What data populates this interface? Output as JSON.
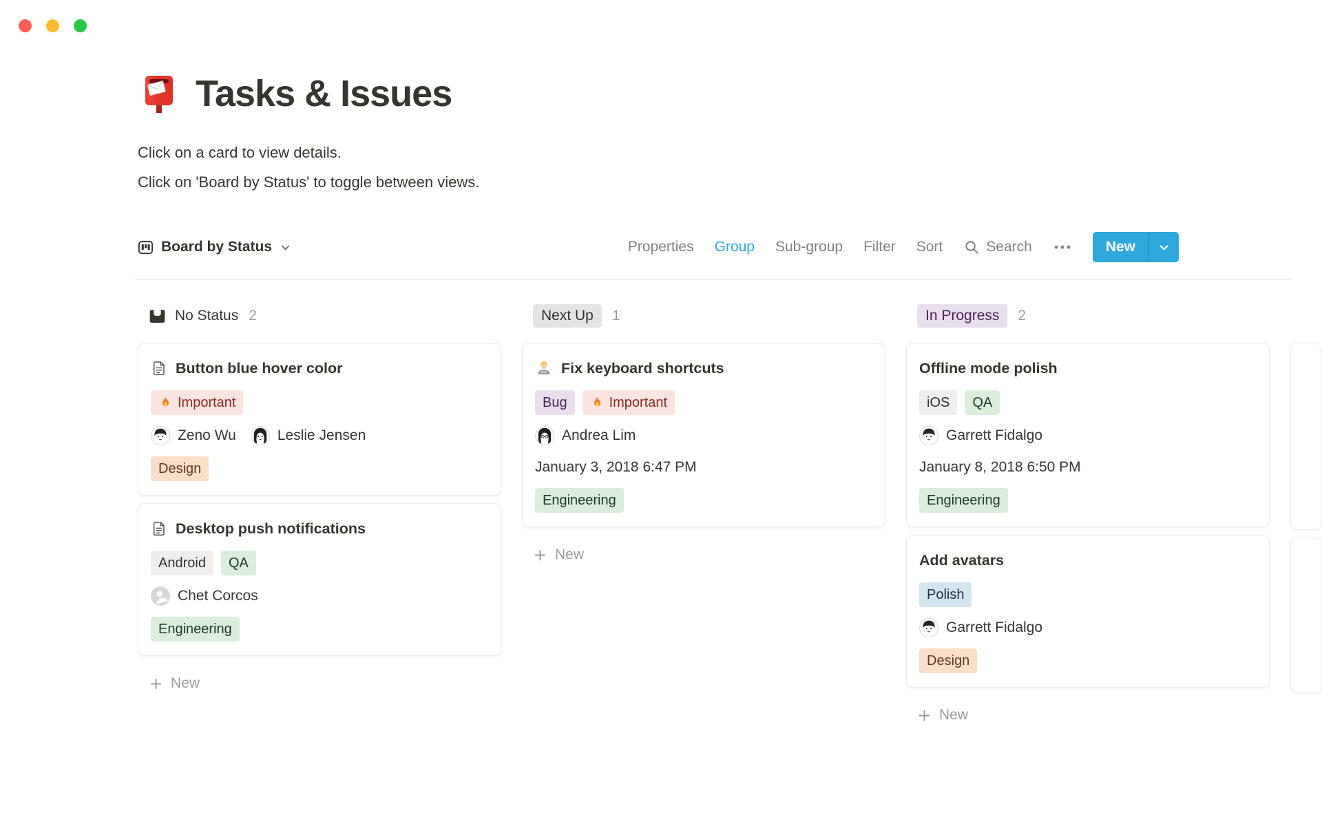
{
  "window": {
    "traffic_lights": [
      "close",
      "minimize",
      "zoom"
    ]
  },
  "page": {
    "icon": "mailbox-icon",
    "title": "Tasks & Issues",
    "description_line1": "Click on a card to view details.",
    "description_line2": "Click on 'Board by Status' to toggle between views."
  },
  "toolbar": {
    "view_selector": {
      "icon": "board-icon",
      "label": "Board by Status"
    },
    "properties_label": "Properties",
    "group_label": "Group",
    "subgroup_label": "Sub-group",
    "filter_label": "Filter",
    "sort_label": "Sort",
    "search_label": "Search",
    "more_label": "•••",
    "new_button_label": "New"
  },
  "board": {
    "columns": [
      {
        "header": {
          "label": "No Status",
          "count": "2",
          "icon": "inbox-icon",
          "style": "plain"
        },
        "cards": [
          {
            "title_icon": "page-icon",
            "title": "Button blue hover color",
            "tags": [
              {
                "label": "Important",
                "color": "red",
                "icon": "fire-icon"
              }
            ],
            "people": [
              {
                "name": "Zeno Wu",
                "avatar": "man-illustration"
              },
              {
                "name": "Leslie Jensen",
                "avatar": "woman-illustration"
              }
            ],
            "footer_tags": [
              {
                "label": "Design",
                "color": "orange"
              }
            ]
          },
          {
            "title_icon": "page-icon",
            "title": "Desktop push notifications",
            "tags": [
              {
                "label": "Android",
                "color": "gray"
              },
              {
                "label": "QA",
                "color": "green"
              }
            ],
            "people": [
              {
                "name": "Chet Corcos",
                "avatar": "placeholder"
              }
            ],
            "footer_tags": [
              {
                "label": "Engineering",
                "color": "green"
              }
            ]
          }
        ],
        "new_label": "New"
      },
      {
        "header": {
          "label": "Next Up",
          "count": "1",
          "style": "gray-pill"
        },
        "cards": [
          {
            "title_icon": "technologist-icon",
            "title": "Fix keyboard shortcuts",
            "tags": [
              {
                "label": "Bug",
                "color": "purple"
              },
              {
                "label": "Important",
                "color": "red",
                "icon": "fire-icon"
              }
            ],
            "people": [
              {
                "name": "Andrea Lim",
                "avatar": "woman-glasses-illustration"
              }
            ],
            "date": "January 3, 2018 6:47 PM",
            "footer_tags": [
              {
                "label": "Engineering",
                "color": "green"
              }
            ]
          }
        ],
        "new_label": "New"
      },
      {
        "header": {
          "label": "In Progress",
          "count": "2",
          "style": "purple-pill"
        },
        "cards": [
          {
            "title": "Offline mode polish",
            "tags": [
              {
                "label": "iOS",
                "color": "gray"
              },
              {
                "label": "QA",
                "color": "green"
              }
            ],
            "people": [
              {
                "name": "Garrett Fidalgo",
                "avatar": "man-illustration"
              }
            ],
            "date": "January 8, 2018 6:50 PM",
            "footer_tags": [
              {
                "label": "Engineering",
                "color": "green"
              }
            ]
          },
          {
            "title": "Add avatars",
            "tags": [
              {
                "label": "Polish",
                "color": "blue"
              }
            ],
            "people": [
              {
                "name": "Garrett Fidalgo",
                "avatar": "man-illustration"
              }
            ],
            "footer_tags": [
              {
                "label": "Design",
                "color": "orange"
              }
            ]
          }
        ],
        "new_label": "New"
      }
    ]
  },
  "colors": {
    "accent_blue": "#2EA7DC",
    "text_primary": "#37352F",
    "text_gray": "#82807B",
    "count_gray": "#9D9C99",
    "divider": "#E4E3E1",
    "tag_red_bg": "#FBE4E0",
    "tag_red_text": "#8A2A22",
    "tag_orange_bg": "#FADEC9",
    "tag_orange_text": "#5C3A1E",
    "tag_green_bg": "#DBEDDB",
    "tag_green_text": "#1C3829",
    "tag_purple_bg": "#E8DEEE",
    "tag_purple_text": "#47265C",
    "tag_blue_bg": "#D3E5EF",
    "tag_blue_text": "#183347",
    "tag_gray_bg": "#EFEEEC",
    "tag_gray_text": "#32302C",
    "column_pill_gray_bg": "#E5E4E2",
    "column_pill_purple_bg": "#E8DEEE",
    "traffic_red": "#FE5F57",
    "traffic_yellow": "#FEBC2E",
    "traffic_green": "#28C840"
  }
}
